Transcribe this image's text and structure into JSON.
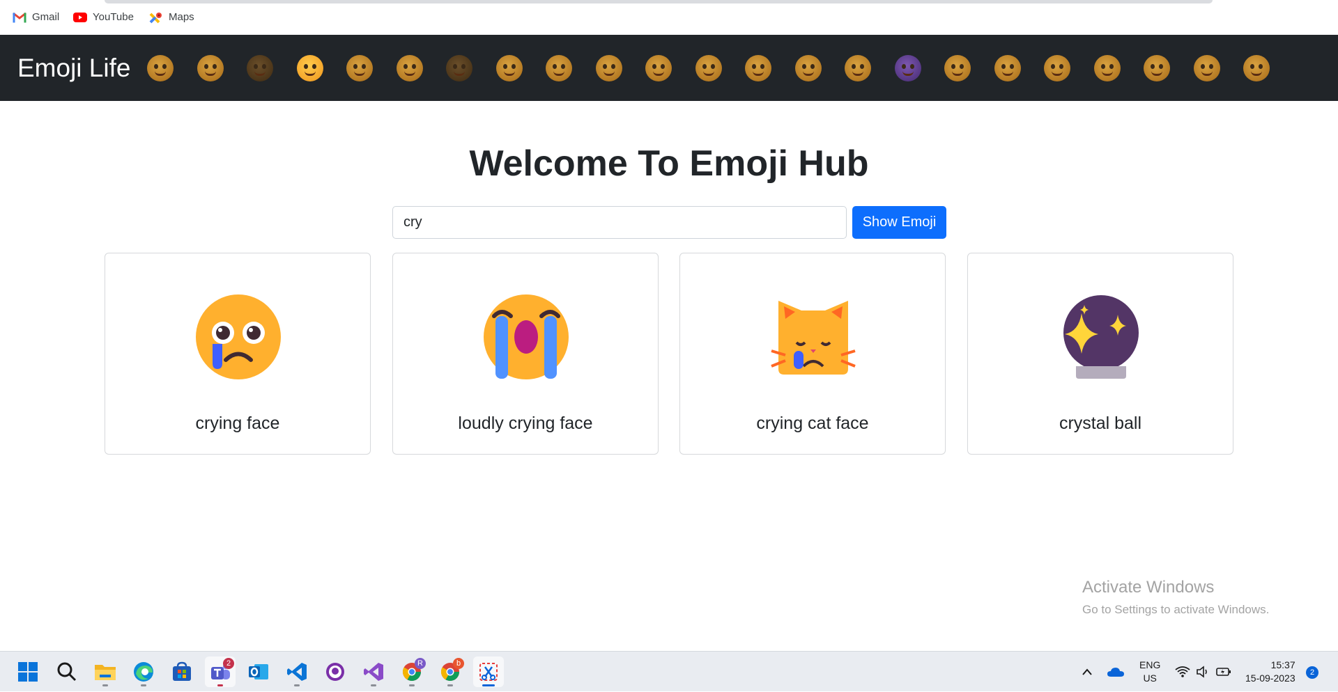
{
  "bookmarks": [
    {
      "label": "Gmail",
      "icon": "gmail-icon"
    },
    {
      "label": "YouTube",
      "icon": "youtube-icon"
    },
    {
      "label": "Maps",
      "icon": "maps-icon"
    }
  ],
  "navbar": {
    "brand": "Emoji Life",
    "emojis": [
      "smiling face with smiling eyes",
      "face savoring food",
      "relieved face",
      "smiling face with halo",
      "smiling face with heart-eyes",
      "smiling face with sunglasses",
      "face blowing a kiss",
      "grinning face",
      "grinning face with big eyes",
      "grinning squinting face",
      "grinning face with smiling eyes",
      "beaming face",
      "grinning face with sweat",
      "squinting face",
      "smiling face with halo",
      "smiling face with horns",
      "winking face",
      "smiling face",
      "face savoring food",
      "relieved face",
      "smiling face with heart-eyes",
      "smiling face with sunglasses",
      "smirking face"
    ]
  },
  "main": {
    "title": "Welcome To Emoji Hub",
    "search_value": "cry",
    "button_label": "Show Emoji"
  },
  "cards": [
    {
      "name": "crying face",
      "icon": "crying-face-icon"
    },
    {
      "name": "loudly crying face",
      "icon": "loudly-crying-face-icon"
    },
    {
      "name": "crying cat face",
      "icon": "crying-cat-face-icon"
    },
    {
      "name": "crystal ball",
      "icon": "crystal-ball-icon"
    }
  ],
  "watermark": {
    "line1": "Activate Windows",
    "line2": "Go to Settings to activate Windows."
  },
  "taskbar": {
    "apps": [
      "start",
      "search",
      "file-explorer",
      "edge",
      "store",
      "teams",
      "outlook",
      "vscode",
      "github-desktop",
      "visual-studio",
      "chrome-profile-r",
      "chrome-profile-b",
      "snipping-tool"
    ],
    "teams_badge": "2",
    "chrome_r_badge": "R",
    "chrome_b_badge": "b",
    "lang_line1": "ENG",
    "lang_line2": "US",
    "time": "15:37",
    "date": "15-09-2023",
    "notifications": "2"
  },
  "colors": {
    "navbar_bg": "#212529",
    "button_bg": "#0d6efd"
  }
}
